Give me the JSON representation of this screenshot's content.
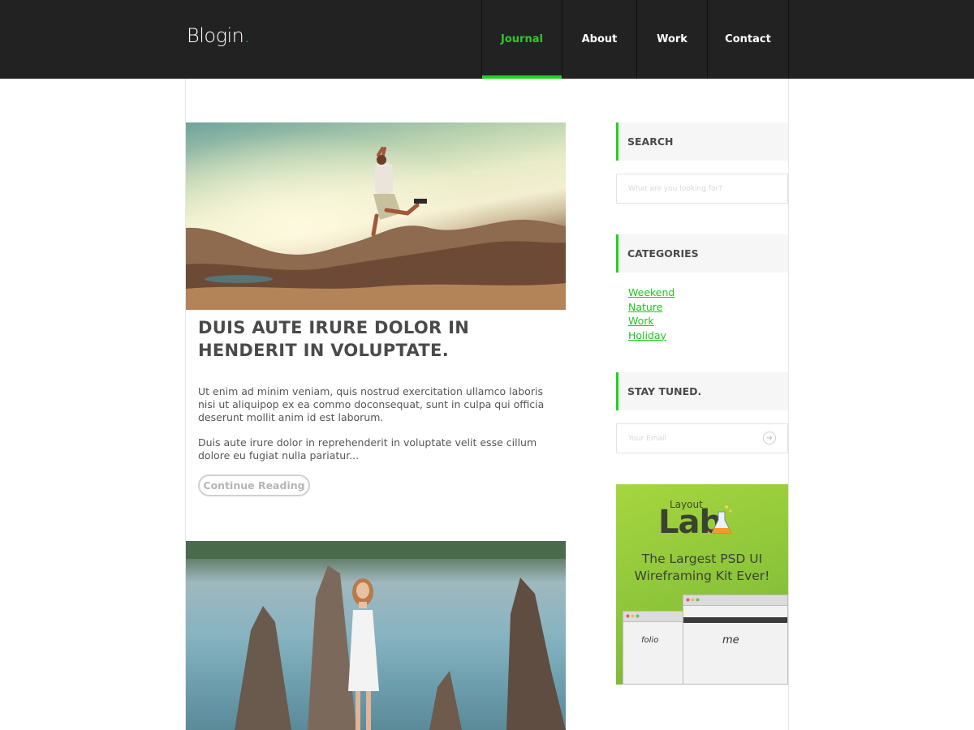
{
  "header": {
    "logo_text": "Blogin",
    "logo_dot": ".",
    "nav": [
      {
        "label": "Journal",
        "active": true
      },
      {
        "label": "About",
        "active": false
      },
      {
        "label": "Work",
        "active": false
      },
      {
        "label": "Contact",
        "active": false
      }
    ]
  },
  "post": {
    "title": "DUIS AUTE IRURE DOLOR IN HENDERIT IN VOLUPTATE.",
    "paragraphs": [
      "Ut enim ad minim veniam, quis nostrud exercitation ullamco laboris nisi ut aliquipop ex ea commo doconsequat, sunt in culpa qui officia deserunt mollit anim id est laborum.",
      "Duis aute irure dolor in reprehenderit in voluptate velit esse cillum dolore eu fugiat nulla pariatur..."
    ],
    "button_label": "Continue Reading"
  },
  "sidebar": {
    "search": {
      "heading": "SEARCH",
      "placeholder": "What are you looking for?"
    },
    "categories": {
      "heading": "CATEGORIES",
      "items": [
        "Weekend",
        "Nature",
        "Work",
        "Holiday"
      ]
    },
    "newsletter": {
      "heading": "STAY TUNED.",
      "placeholder": "Your Email",
      "submit_icon": "arrow-right-circle-icon"
    },
    "ad": {
      "brand_small": "Layout",
      "brand": "Lab",
      "tagline_line1": "The Largest PSD UI",
      "tagline_line2": "Wireframing Kit Ever!",
      "mock_logo_1": "folio",
      "mock_logo_2": "me"
    }
  },
  "colors": {
    "header_bg": "#222222",
    "accent_green": "#1ed41e",
    "widget_bg": "#f6f6f6",
    "text": "#555555",
    "ad_bg": "#8cc43a"
  }
}
